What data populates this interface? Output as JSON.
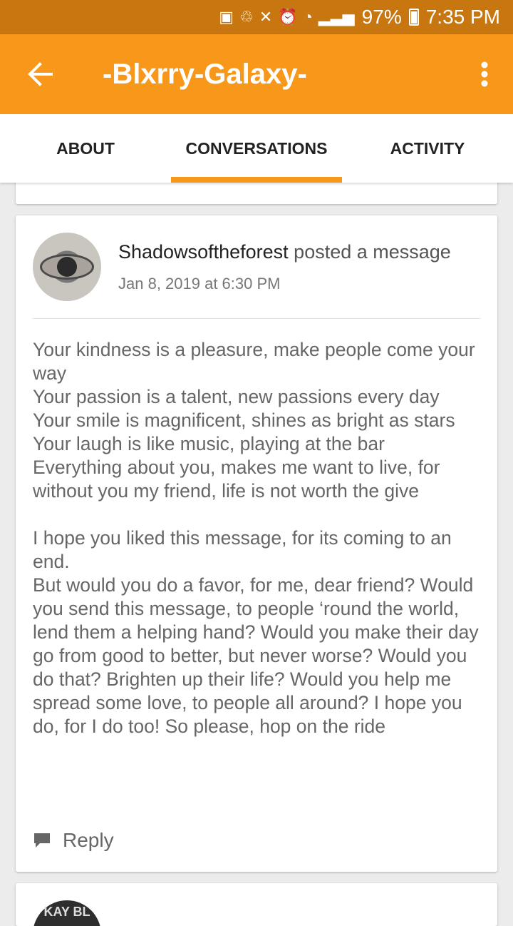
{
  "status_bar": {
    "battery": "97%",
    "time": "7:35 PM"
  },
  "app_bar": {
    "title": "-Blxrry-Galaxy-"
  },
  "tabs": [
    {
      "label": "ABOUT",
      "active": false
    },
    {
      "label": "CONVERSATIONS",
      "active": true
    },
    {
      "label": "ACTIVITY",
      "active": false
    }
  ],
  "post": {
    "author": "Shadowsoftheforest",
    "action": "posted a message",
    "timestamp": "Jan 8, 2019 at 6:30 PM",
    "message_lines": [
      "Your kindness is a pleasure, make people come your way",
      "Your passion is a talent, new passions every day",
      "Your smile is magnificent, shines as bright as stars",
      "Your laugh is like music, playing at the bar",
      "Everything about you, makes me want to live, for without you my friend, life is not worth the give",
      "",
      "I hope you liked this message, for its coming to an end.",
      "But would you do a favor, for me, dear friend? Would you send this message, to people ‘round the world, lend them a helping hand? Would you make their day go from good to better, but never worse? Would you do that? Brighten up their life? Would you help me spread some love, to people all around? I hope you do, for I do too! So please, hop on the ride"
    ],
    "reply_label": "Reply"
  },
  "next_post": {
    "avatar_text": "KAY BL"
  },
  "colors": {
    "status_bar": "#c8760f",
    "app_bar": "#f7981a",
    "tab_indicator": "#f7981a"
  }
}
